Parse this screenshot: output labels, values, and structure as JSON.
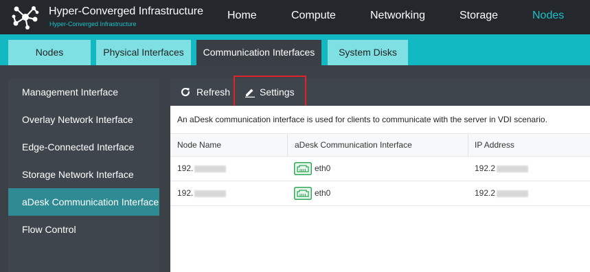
{
  "app": {
    "title": "Hyper-Converged Infrastructure",
    "subtitle": "Hyper-Converged Infrastructure",
    "logo_icon": "molecule-network-logo"
  },
  "nav": {
    "items": [
      {
        "label": "Home"
      },
      {
        "label": "Compute"
      },
      {
        "label": "Networking"
      },
      {
        "label": "Storage"
      },
      {
        "label": "Nodes"
      }
    ],
    "active": "Nodes"
  },
  "subtabs": {
    "items": [
      {
        "label": "Nodes"
      },
      {
        "label": "Physical Interfaces"
      },
      {
        "label": "Communication Interfaces"
      },
      {
        "label": "System Disks"
      }
    ],
    "active": "Communication Interfaces"
  },
  "sidebar": {
    "items": [
      {
        "label": "Management Interface"
      },
      {
        "label": "Overlay Network Interface"
      },
      {
        "label": "Edge-Connected Interface"
      },
      {
        "label": "Storage Network Interface"
      },
      {
        "label": "aDesk Communication Interface"
      },
      {
        "label": "Flow Control"
      }
    ],
    "active": "aDesk Communication Interface"
  },
  "toolbar": {
    "refresh_label": "Refresh",
    "refresh_icon": "refresh-icon",
    "settings_label": "Settings",
    "settings_icon": "pencil-icon"
  },
  "description": "An aDesk communication interface is used for clients to communicate with the server in VDI scenario.",
  "table": {
    "columns": [
      "Node Name",
      "aDesk Communication Interface",
      "IP Address"
    ],
    "rows": [
      {
        "node": "192.",
        "interface": "eth0",
        "ip": "192.2"
      },
      {
        "node": "192.",
        "interface": "eth0",
        "ip": "192.2"
      }
    ]
  },
  "colors": {
    "accent": "#19c2c8",
    "topbar": "#24282d",
    "subbar": "#12b9c2",
    "highlight": "#e0222a",
    "nic_icon": "#2fa85a"
  }
}
